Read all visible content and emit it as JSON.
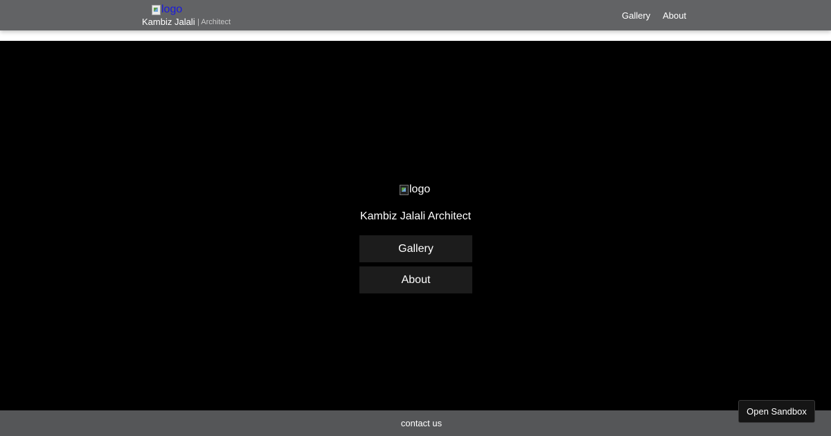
{
  "header": {
    "logo_alt": "logo",
    "brand_name": "Kambiz Jalali",
    "brand_sub": "| Architect",
    "nav": [
      "Gallery",
      "About"
    ]
  },
  "hero": {
    "logo_alt": "logo",
    "title": "Kambiz Jalali Architect",
    "buttons": [
      "Gallery",
      "About"
    ]
  },
  "footer": {
    "contact": "contact us"
  },
  "sandbox": {
    "label": "Open Sandbox"
  },
  "colors": {
    "header_bg": "#626365",
    "hero_bg": "#000000",
    "button_bg": "#1c1c1c",
    "footer_bg": "#555658",
    "logo_alt_link": "#1a1adb"
  }
}
